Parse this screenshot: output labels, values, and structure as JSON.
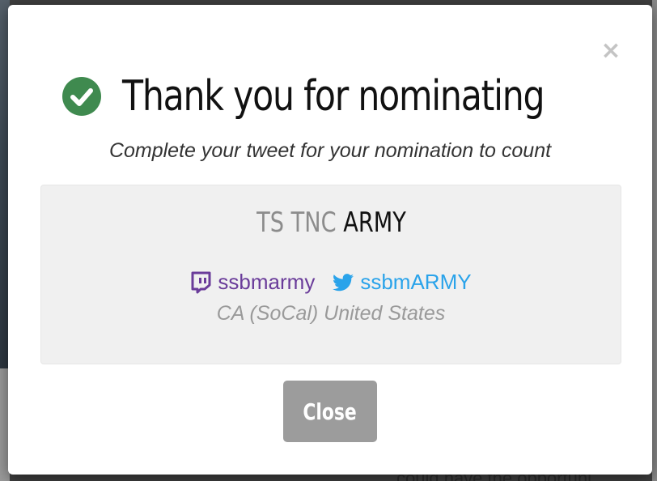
{
  "modal": {
    "close_icon": "close-icon",
    "title": "Thank you for nominating",
    "title_icon": "check-circle-icon",
    "subtitle": "Complete your tweet for your nomination to count",
    "nominee": {
      "team_prefix": "TS TNC",
      "team_name": "ARMY",
      "twitch": {
        "icon": "twitch-icon",
        "handle": "ssbmarmy",
        "color": "#6a3c9a"
      },
      "twitter": {
        "icon": "twitter-icon",
        "handle": "ssbmARMY",
        "color": "#2aa3ea"
      },
      "location": "CA (SoCal) United States"
    },
    "close_button_label": "Close"
  },
  "background": {
    "bottom_text": "could have the opportuni"
  },
  "colors": {
    "check_green": "#3f8a4f",
    "panel_bg": "#f0f0f0",
    "button_bg": "#9c9c9c"
  }
}
